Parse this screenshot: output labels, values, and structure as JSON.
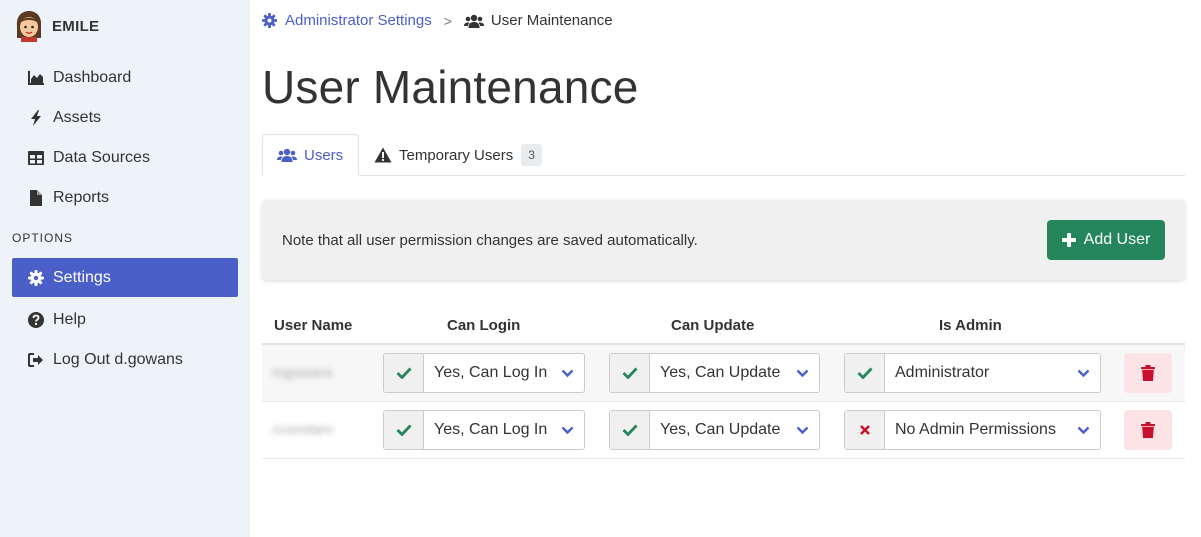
{
  "app": {
    "name": "EMILE",
    "accent": "#4b5fc9",
    "success": "#24865a",
    "danger": "#c8102e"
  },
  "sidebar": {
    "items": [
      {
        "label": "Dashboard",
        "icon": "chart-area-icon"
      },
      {
        "label": "Assets",
        "icon": "bolt-icon"
      },
      {
        "label": "Data Sources",
        "icon": "table-icon"
      },
      {
        "label": "Reports",
        "icon": "file-icon"
      }
    ],
    "section_label": "OPTIONS",
    "options": [
      {
        "label": "Settings",
        "icon": "gear-icon",
        "active": true
      },
      {
        "label": "Help",
        "icon": "question-circle-icon"
      },
      {
        "label": "Log Out d.gowans",
        "icon": "sign-out-icon"
      }
    ]
  },
  "breadcrumb": {
    "parent": "Administrator Settings",
    "separator": ">",
    "current": "User Maintenance"
  },
  "page_title": "User Maintenance",
  "tabs": [
    {
      "label": "Users",
      "icon": "users-icon",
      "active": true
    },
    {
      "label": "Temporary Users",
      "icon": "warning-icon",
      "badge": "3"
    }
  ],
  "notice": {
    "text": "Note that all user permission changes are saved automatically.",
    "button_label": "Add User"
  },
  "table": {
    "headers": {
      "user_name": "User Name",
      "can_login": "Can Login",
      "can_update": "Can Update",
      "is_admin": "Is Admin"
    },
    "rows": [
      {
        "user_name": "rogowans",
        "can_login": "Yes, Can Log In",
        "can_update": "Yes, Can Update",
        "is_admin": "Administrator",
        "admin_state": "check"
      },
      {
        "user_name": "ccsmdaro",
        "can_login": "Yes, Can Log In",
        "can_update": "Yes, Can Update",
        "is_admin": "No Admin Permissions",
        "admin_state": "cross"
      }
    ]
  }
}
